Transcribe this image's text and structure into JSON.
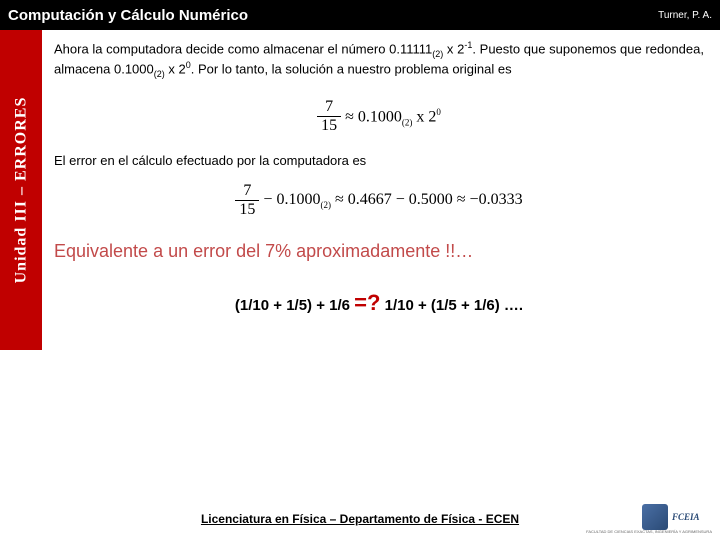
{
  "header": {
    "title": "Computación y Cálculo Numérico",
    "author": "Turner, P. A."
  },
  "sidebar": {
    "label": "Unidad III – ERRORES"
  },
  "para1": {
    "t1": "Ahora la computadora decide como almacenar el número 0.11111",
    "t2": " x 2",
    "t3": ". Puesto que suponemos que redondea, almacena 0.1000",
    "t4": " x 2",
    "t5": ". Por lo tanto, la solución a nuestro problema original es",
    "sub1": "(2)",
    "sup1": "-1",
    "sub2": "(2)",
    "sup2": "0"
  },
  "eq1": {
    "num": "7",
    "den": "15",
    "rhs_a": " ≈ 0.1000",
    "rhs_sub": "(2)",
    "rhs_b": " x 2",
    "rhs_sup": "0"
  },
  "para2": "El error en el cálculo efectuado por la computadora es",
  "eq2": {
    "num": "7",
    "den": "15",
    "minus": " − 0.1000",
    "sub": "(2)",
    "approx": " ≈ 0.4667 − 0.5000 ≈ −0.0333"
  },
  "highlight": "Equivalente a un error del 7% aproximadamente !!…",
  "question": {
    "left": "(1/10 + 1/5) + 1/6 ",
    "eq": "=?",
    "right": " 1/10 + (1/5 + 1/6) …."
  },
  "footer": "Licenciatura en Física – Departamento de Física - ECEN",
  "logo": {
    "text": "FCEIA",
    "sub": "FACULTAD DE CIENCIAS EXACTAS, INGENIERÍA Y AGRIMENSURA"
  }
}
